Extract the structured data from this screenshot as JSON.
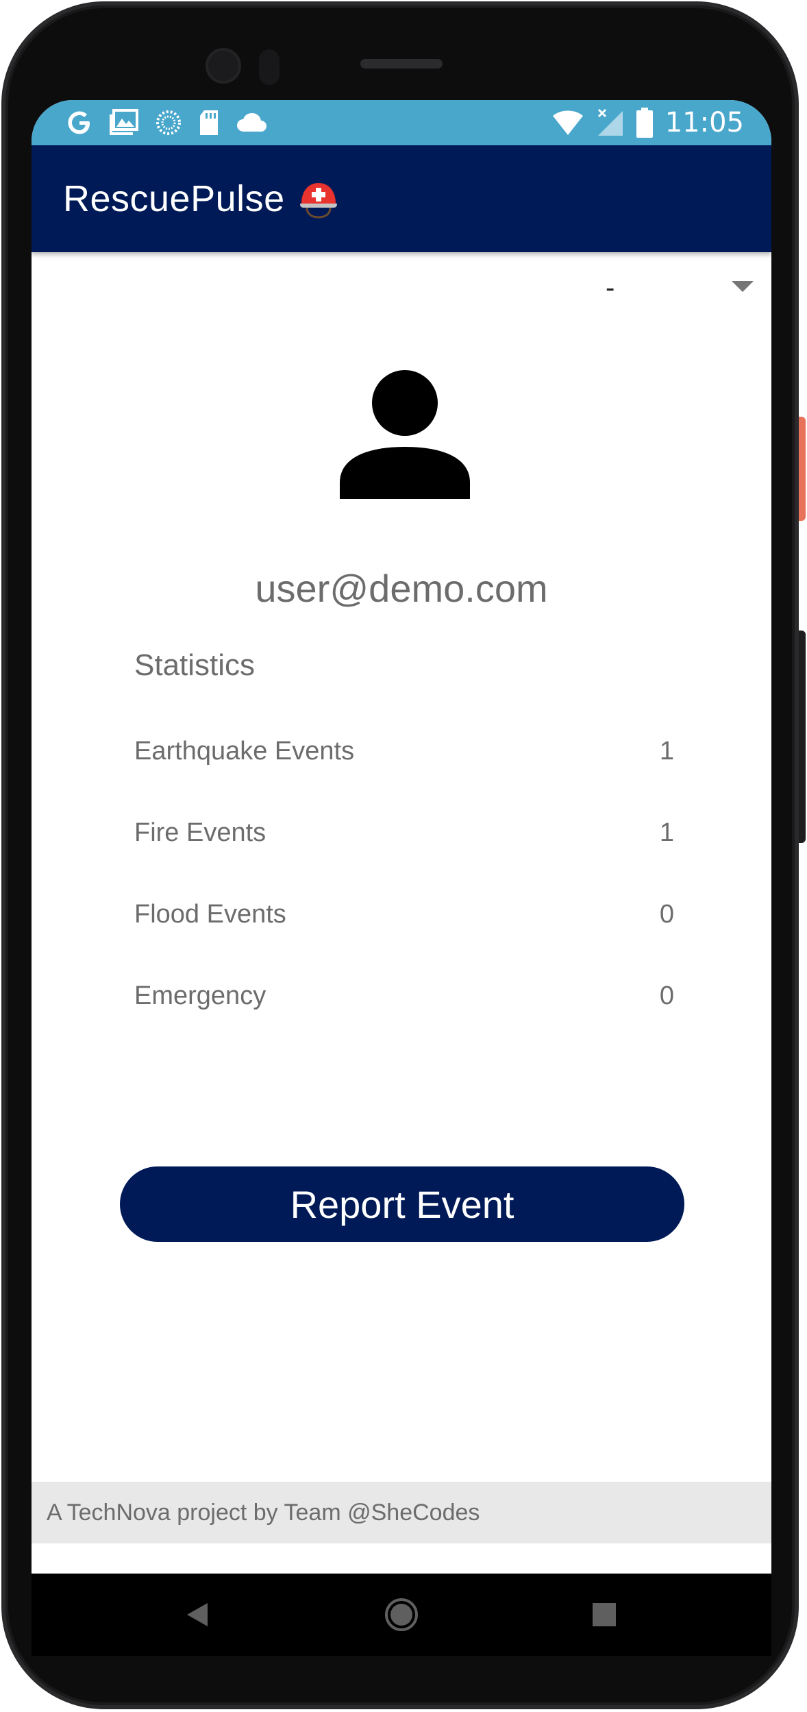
{
  "status_bar": {
    "time": "11:05",
    "left_icons": [
      "google-icon",
      "gallery-icon",
      "sync-icon",
      "sd-card-icon",
      "cloud-icon"
    ],
    "right_icons": [
      "wifi-icon",
      "no-signal-icon",
      "battery-icon"
    ]
  },
  "app_bar": {
    "title": "RescuePulse",
    "title_icon": "rescue-helmet-icon",
    "background": "#001a57"
  },
  "dropdown": {
    "selected": "-"
  },
  "profile": {
    "avatar_icon": "person-icon",
    "email": "user@demo.com"
  },
  "statistics": {
    "title": "Statistics",
    "rows": [
      {
        "label": "Earthquake Events",
        "value": "1"
      },
      {
        "label": "Fire Events",
        "value": "1"
      },
      {
        "label": "Flood Events",
        "value": "0"
      },
      {
        "label": "Emergency",
        "value": "0"
      }
    ]
  },
  "report_button": {
    "label": "Report Event",
    "color": "#001a57"
  },
  "footer": {
    "text": "A TechNova project by Team @SheCodes"
  },
  "nav_bar": {
    "buttons": [
      "back-icon",
      "home-icon",
      "recents-icon"
    ]
  }
}
